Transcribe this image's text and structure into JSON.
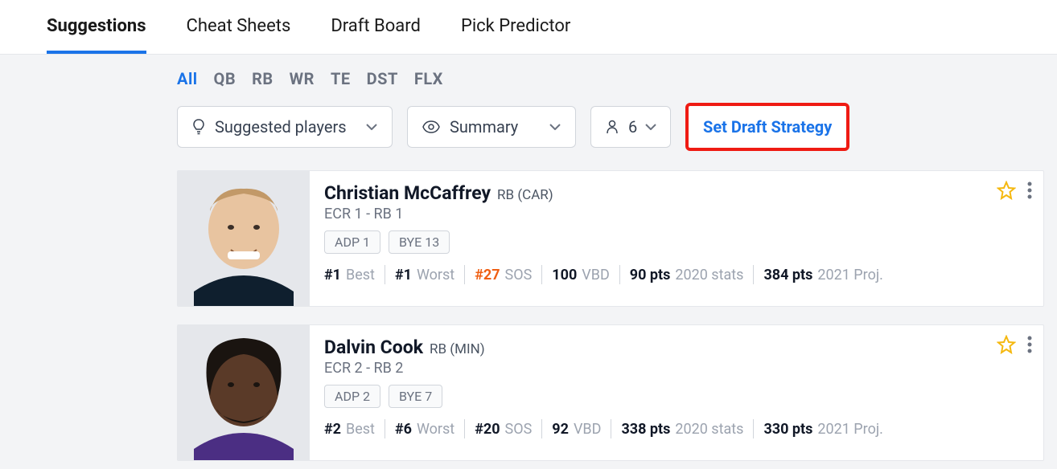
{
  "top_tabs": {
    "suggestions": "Suggestions",
    "cheat_sheets": "Cheat Sheets",
    "draft_board": "Draft Board",
    "pick_predictor": "Pick Predictor"
  },
  "position_tabs": {
    "all": "All",
    "qb": "QB",
    "rb": "RB",
    "wr": "WR",
    "te": "TE",
    "dst": "DST",
    "flx": "FLX"
  },
  "controls": {
    "suggested_label": "Suggested players",
    "summary_label": "Summary",
    "count": "6",
    "strategy_label": "Set Draft Strategy"
  },
  "players": [
    {
      "name": "Christian McCaffrey",
      "pos": "RB (CAR)",
      "ecr": "ECR 1 - RB 1",
      "adp": "ADP 1",
      "bye": "BYE 13",
      "best": "#1",
      "worst": "#1",
      "sos": "#27",
      "vbd": "100",
      "pts_prev": "90 pts",
      "prev_label": "2020 stats",
      "pts_proj": "384 pts",
      "proj_label": "2021 Proj."
    },
    {
      "name": "Dalvin Cook",
      "pos": "RB (MIN)",
      "ecr": "ECR 2 - RB 2",
      "adp": "ADP 2",
      "bye": "BYE 7",
      "best": "#2",
      "worst": "#6",
      "sos": "#20",
      "vbd": "92",
      "pts_prev": "338 pts",
      "prev_label": "2020 stats",
      "pts_proj": "330 pts",
      "proj_label": "2021 Proj."
    }
  ],
  "stat_labels": {
    "best": "Best",
    "worst": "Worst",
    "sos": "SOS",
    "vbd": "VBD"
  }
}
